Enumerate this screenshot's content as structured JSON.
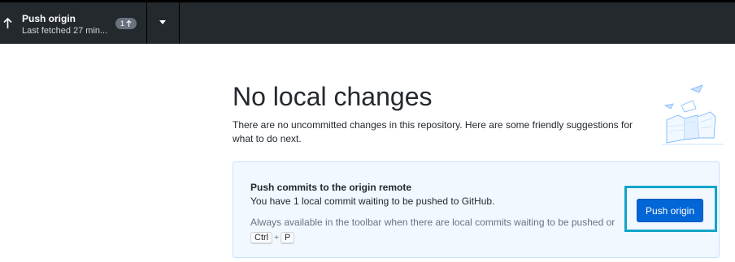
{
  "toolbar": {
    "push_title": "Push origin",
    "push_subtitle": "Last fetched 27 min...",
    "ahead_count": "1",
    "icons": {
      "push": "arrow-up-icon",
      "ahead": "arrow-up-icon",
      "dropdown": "triangle-down-icon"
    }
  },
  "main": {
    "heading": "No local changes",
    "description": "There are no uncommitted changes in this repository. Here are some friendly suggestions for what to do next.",
    "illustration_icon": "empty-repo-illustration-icon",
    "card": {
      "title": "Push commits to the origin remote",
      "description": "You have 1 local commit waiting to be pushed to GitHub.",
      "hint": "Always available in the toolbar when there are local commits waiting to be pushed or",
      "shortcut_keys": [
        "Ctrl",
        "P"
      ],
      "shortcut_separator": "+",
      "button_label": "Push origin"
    }
  },
  "colors": {
    "toolbar_bg": "#24292e",
    "accent_button": "#0366d6",
    "card_bg": "#f1f8ff",
    "focus_ring": "#10a5c7"
  }
}
